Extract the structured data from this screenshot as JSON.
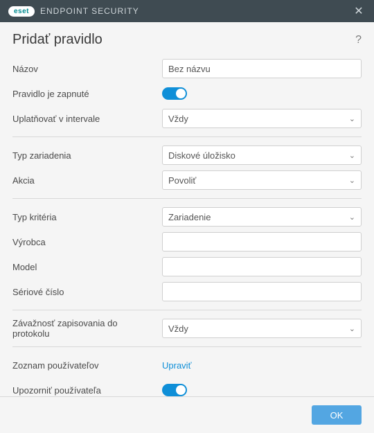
{
  "titlebar": {
    "brand": "eset",
    "product": "ENDPOINT SECURITY"
  },
  "page": {
    "title": "Pridať pravidlo"
  },
  "fields": {
    "name": {
      "label": "Názov",
      "value": "Bez názvu"
    },
    "enabled": {
      "label": "Pravidlo je zapnuté",
      "value": true
    },
    "interval": {
      "label": "Uplatňovať v intervale",
      "value": "Vždy"
    },
    "device_type": {
      "label": "Typ zariadenia",
      "value": "Diskové úložisko"
    },
    "action": {
      "label": "Akcia",
      "value": "Povoliť"
    },
    "criteria_type": {
      "label": "Typ kritéria",
      "value": "Zariadenie"
    },
    "vendor": {
      "label": "Výrobca",
      "value": ""
    },
    "model": {
      "label": "Model",
      "value": ""
    },
    "serial": {
      "label": "Sériové číslo",
      "value": ""
    },
    "log_severity": {
      "label": "Závažnosť zapisovania do protokolu",
      "value": "Vždy"
    },
    "user_list": {
      "label": "Zoznam používateľov",
      "action": "Upraviť"
    },
    "notify_user": {
      "label": "Upozorniť používateľa",
      "value": true
    }
  },
  "buttons": {
    "ok": "OK"
  }
}
